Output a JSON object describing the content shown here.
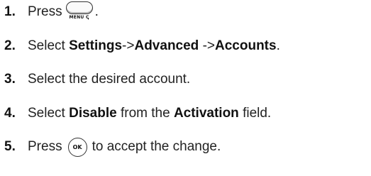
{
  "steps": [
    {
      "number": "1.",
      "text_before": "Press",
      "key": {
        "label": "MENU ↅ",
        "icon": "menu-key-icon"
      },
      "text_after": "."
    },
    {
      "number": "2.",
      "text_before": "Select ",
      "bold1": "Settings",
      "sep1": "->",
      "bold2": "Advanced",
      "sep2": " ->",
      "bold3": "Accounts",
      "end": "."
    },
    {
      "number": "3.",
      "text": "Select the desired account."
    },
    {
      "number": "4.",
      "text_before": "Select ",
      "bold1": "Disable",
      "mid": " from the ",
      "bold2": "Activation",
      "end": " field."
    },
    {
      "number": "5.",
      "text_before": "Press",
      "key": {
        "label": "OK",
        "icon": "ok-key-icon"
      },
      "text_after": "to accept the change."
    }
  ]
}
